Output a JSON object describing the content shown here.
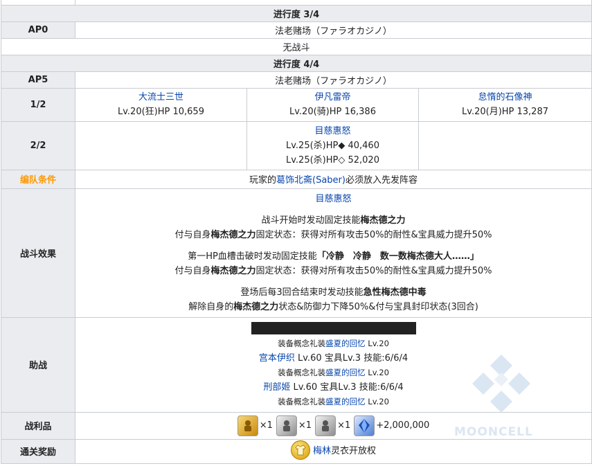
{
  "sections": [
    {
      "progress": "进行度 3/4",
      "ap_label": "AP0",
      "location": "法老赌场（ファラオカジノ）",
      "no_battle": "无战斗"
    },
    {
      "progress": "进行度 4/4",
      "ap_label": "AP5",
      "location": "法老赌场（ファラオカジノ）",
      "wave1": {
        "label": "1/2",
        "enemies": [
          {
            "name": "大流士三世",
            "stats": "Lv.20(狂)HP 10,659"
          },
          {
            "name": "伊凡雷帝",
            "stats": "Lv.20(骑)HP 16,386"
          },
          {
            "name": "怠惰的石像神",
            "stats": "Lv.20(月)HP 13,287"
          }
        ]
      },
      "wave2": {
        "label": "2/2",
        "enemy": {
          "name": "目慈惠怒",
          "stats1": "Lv.25(杀)HP◆ 40,460",
          "stats2": "Lv.25(杀)HP◇ 52,020"
        }
      },
      "formation": {
        "label": "编队条件",
        "pre": "玩家的",
        "servant": "葛饰北斋(Saber)",
        "post": "必须放入先发阵容"
      },
      "battle_effects": {
        "label": "战斗效果",
        "title": "目慈惠怒",
        "e1_pre": "战斗开始时发动固定技能",
        "e1_skill": "梅杰德之力",
        "e1b_pre": "付与自身",
        "e1b_skill": "梅杰德之力",
        "e1b_post": "固定状态：获得对所有攻击50%的耐性&宝具威力提升50%",
        "e2_pre": "第一HP血槽击破时发动固定技能",
        "e2_skill": "「冷静　冷静　数一数梅杰德大人……」",
        "e2b_pre": "付与自身",
        "e2b_skill": "梅杰德之力",
        "e2b_post": "固定状态：获得对所有攻击50%的耐性&宝具威力提升50%",
        "e3_pre": "登场后每3回合结束时发动技能",
        "e3_skill": "急性梅杰德中毒",
        "e3b_pre": "解除自身的",
        "e3b_skill": "梅杰德之力",
        "e3b_post": "状态&防御力下降50%&付与宝具封印状态(3回合)"
      },
      "support": {
        "label": "助战",
        "ce1_pre": "装备概念礼装",
        "ce1_name": "盛夏的回忆",
        "ce1_lv": " Lv.20",
        "s1_name": "宫本伊织",
        "s1_info": " Lv.60 宝具Lv.3 技能:6/6/4",
        "ce2_pre": "装备概念礼装",
        "ce2_name": "盛夏的回忆",
        "ce2_lv": " Lv.20",
        "s2_name": "刑部姬",
        "s2_info": " Lv.60 宝具Lv.3 技能:6/6/4",
        "ce3_pre": "装备概念礼装",
        "ce3_name": "盛夏的回忆",
        "ce3_lv": " Lv.20"
      },
      "loot": {
        "label": "战利品",
        "q1": "×1",
        "q2": "×1",
        "q3": "×1",
        "qp": "+2,000,000"
      },
      "clear_reward": {
        "label": "通关奖励",
        "item": "梅林",
        "suffix": "灵衣开放权"
      }
    }
  ],
  "watermark": "MOONCELL",
  "colors": {
    "header_bg": "#eaecf0",
    "border": "#c8ccd1",
    "link": "#0645ad",
    "formation_label": "#ff9900"
  }
}
